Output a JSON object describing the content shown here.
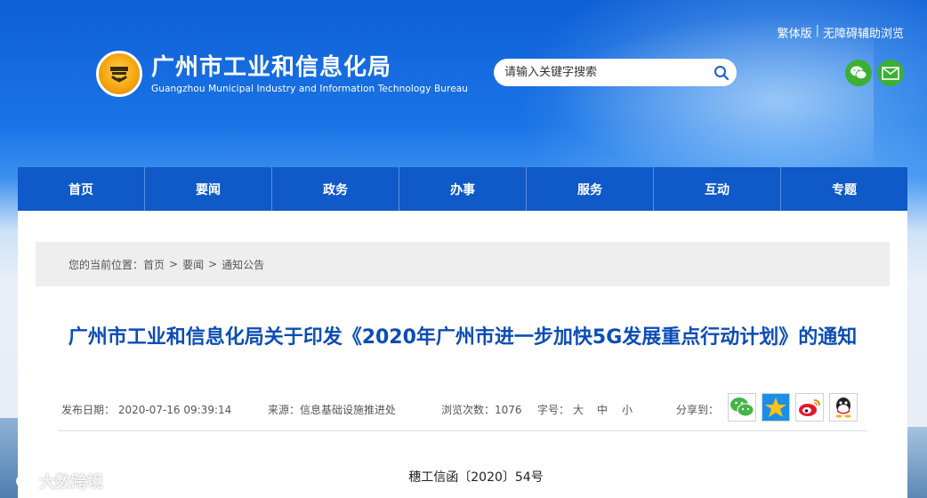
{
  "header": {
    "top_links": [
      "繁体版",
      "|",
      "无障碍辅助浏览"
    ],
    "logo_cn": "广州市工业和信息化局",
    "logo_en": "Guangzhou Municipal Industry and Information Technology Bureau",
    "search_placeholder": "请输入关键字搜索"
  },
  "nav": [
    "首页",
    "要闻",
    "政务",
    "办事",
    "服务",
    "互动",
    "专题"
  ],
  "breadcrumb": {
    "prefix": "您的当前位置：",
    "items": [
      "首页",
      ">",
      "要闻",
      ">",
      "通知公告"
    ]
  },
  "article": {
    "title": "广州市工业和信息化局关于印发《2020年广州市进一步加快5G发展重点行动计划》的通知",
    "publish_date": "发布日期：  2020-07-16 09:39:14",
    "source": "来源：信息基础设施推进处",
    "views": "浏览次数：1076",
    "font_size_label": "字号：",
    "font_sizes": [
      "大",
      "中",
      "小"
    ],
    "share_label": "分享到：",
    "doc_number": "穗工信函〔2020〕54号"
  },
  "watermark": "大数跨境",
  "colors": {
    "nav_bg": "#0f59c8",
    "title": "#0b4db5",
    "wechat_green": "#3cb034"
  },
  "icons": [
    "wechat-icon",
    "mail-icon",
    "search-icon",
    "qzone-icon",
    "weibo-icon",
    "qq-icon"
  ]
}
